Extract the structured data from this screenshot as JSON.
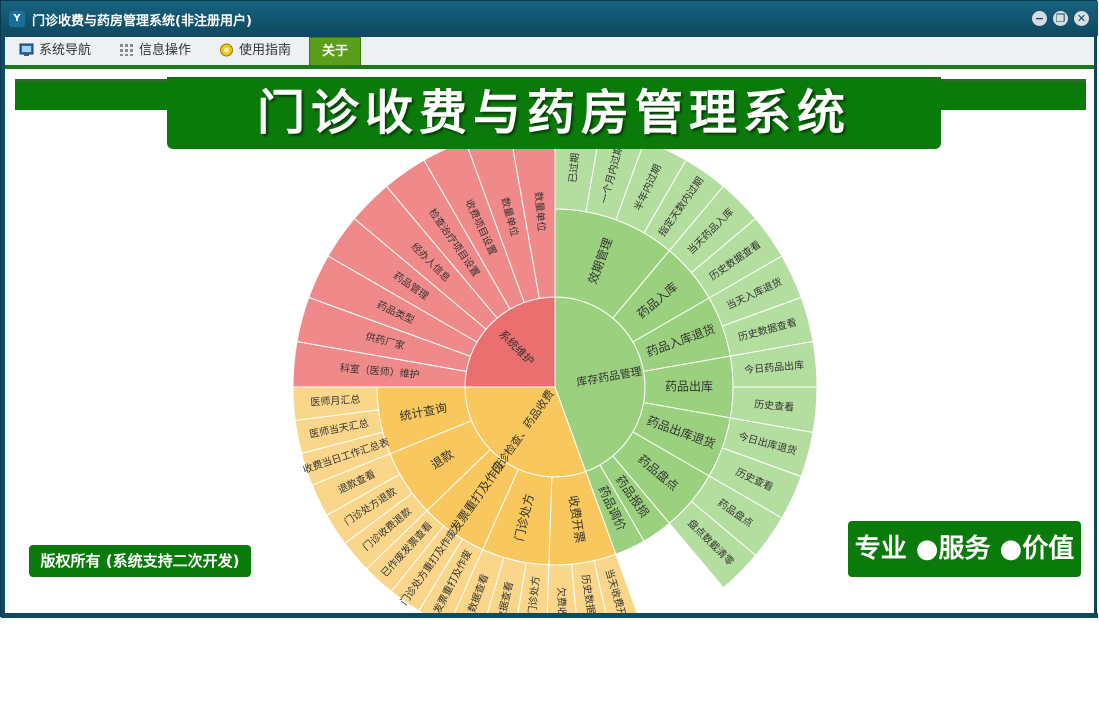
{
  "window": {
    "title": "门诊收费与药房管理系统(非注册用户)",
    "app_icon": "app-icon-yc",
    "minimize": "−",
    "restore": "❐",
    "close": "✕"
  },
  "menu": {
    "items": [
      {
        "label": "系统导航",
        "icon": "monitor-icon"
      },
      {
        "label": "信息操作",
        "icon": "grid-icon"
      },
      {
        "label": "使用指南",
        "icon": "bulb-icon"
      },
      {
        "label": "关于",
        "icon": "",
        "active": true
      }
    ]
  },
  "banner": {
    "title": "门诊收费与药房管理系统"
  },
  "footer": {
    "copyright": "版权所有 (系统支持二次开发)",
    "slogan": "专业 ●服务 ●价值"
  },
  "colors": {
    "green_accent": "#0a7a0a",
    "window_frame": "#0f4a63",
    "sys_maint": "#e86a6a",
    "pharmacy": "#9acf7c",
    "clinic": "#f7c65b"
  },
  "sunburst": {
    "center": {
      "label": ""
    },
    "groups": [
      {
        "label": "系统维护",
        "color": "#ea6f6f",
        "light": "#f08a8a",
        "children": [
          {
            "label": "",
            "children": [
              {
                "label": "科室（医师）维护"
              },
              {
                "label": "供药厂家"
              },
              {
                "label": "药品类型"
              },
              {
                "label": "药品管理"
              },
              {
                "label": "经办人信息"
              },
              {
                "label": "检查治疗项目设置"
              },
              {
                "label": "收费项目设置"
              },
              {
                "label": "数量单位"
              },
              {
                "label": "数量单位"
              }
            ]
          }
        ]
      },
      {
        "label": "库存药品管理",
        "color": "#9bd07e",
        "light": "#b4dda0",
        "children": [
          {
            "label": "效期管理",
            "children": [
              {
                "label": "已过期"
              },
              {
                "label": "一个月内过期"
              },
              {
                "label": "半年内过期"
              },
              {
                "label": "指定天数内过期"
              }
            ]
          },
          {
            "label": "药品入库",
            "children": [
              {
                "label": "当天药品入库"
              },
              {
                "label": "历史数据查看"
              }
            ]
          },
          {
            "label": "药品入库退货",
            "children": [
              {
                "label": "当天入库退货"
              },
              {
                "label": "历史数据查看"
              }
            ]
          },
          {
            "label": "药品出库",
            "children": [
              {
                "label": "今日药品出库"
              },
              {
                "label": "历史查看"
              }
            ]
          },
          {
            "label": "药品出库退货",
            "children": [
              {
                "label": "今日出库退货"
              },
              {
                "label": "历史查看"
              }
            ]
          },
          {
            "label": "药品盘点",
            "children": [
              {
                "label": "药品盘点"
              },
              {
                "label": "盘点数截清零"
              }
            ]
          },
          {
            "label": "药品报损",
            "children": []
          },
          {
            "label": "药品调价",
            "children": []
          }
        ]
      },
      {
        "label": "门诊检查、药品收费",
        "color": "#f8c85e",
        "light": "#fad68a",
        "children": [
          {
            "label": "收费开票",
            "children": [
              {
                "label": "当天收费开票"
              },
              {
                "label": "历史数据查看"
              },
              {
                "label": "欠费收费"
              }
            ]
          },
          {
            "label": "门诊处方",
            "children": [
              {
                "label": "当天门诊处方"
              },
              {
                "label": "数据查看"
              },
              {
                "label": "数据查看"
              }
            ]
          },
          {
            "label": "发票重打及作废",
            "children": [
              {
                "label": "发票重打及作废"
              },
              {
                "label": "门诊处方重打及作废"
              },
              {
                "label": "已作废发票查看"
              }
            ]
          },
          {
            "label": "退款",
            "children": [
              {
                "label": "门诊收费退款"
              },
              {
                "label": "门诊处方退款"
              },
              {
                "label": "退款查看"
              }
            ]
          },
          {
            "label": "统计查询",
            "children": [
              {
                "label": "收费当日工作汇总表"
              },
              {
                "label": "医师当天汇总"
              },
              {
                "label": "医师月汇总"
              }
            ]
          }
        ]
      }
    ]
  }
}
